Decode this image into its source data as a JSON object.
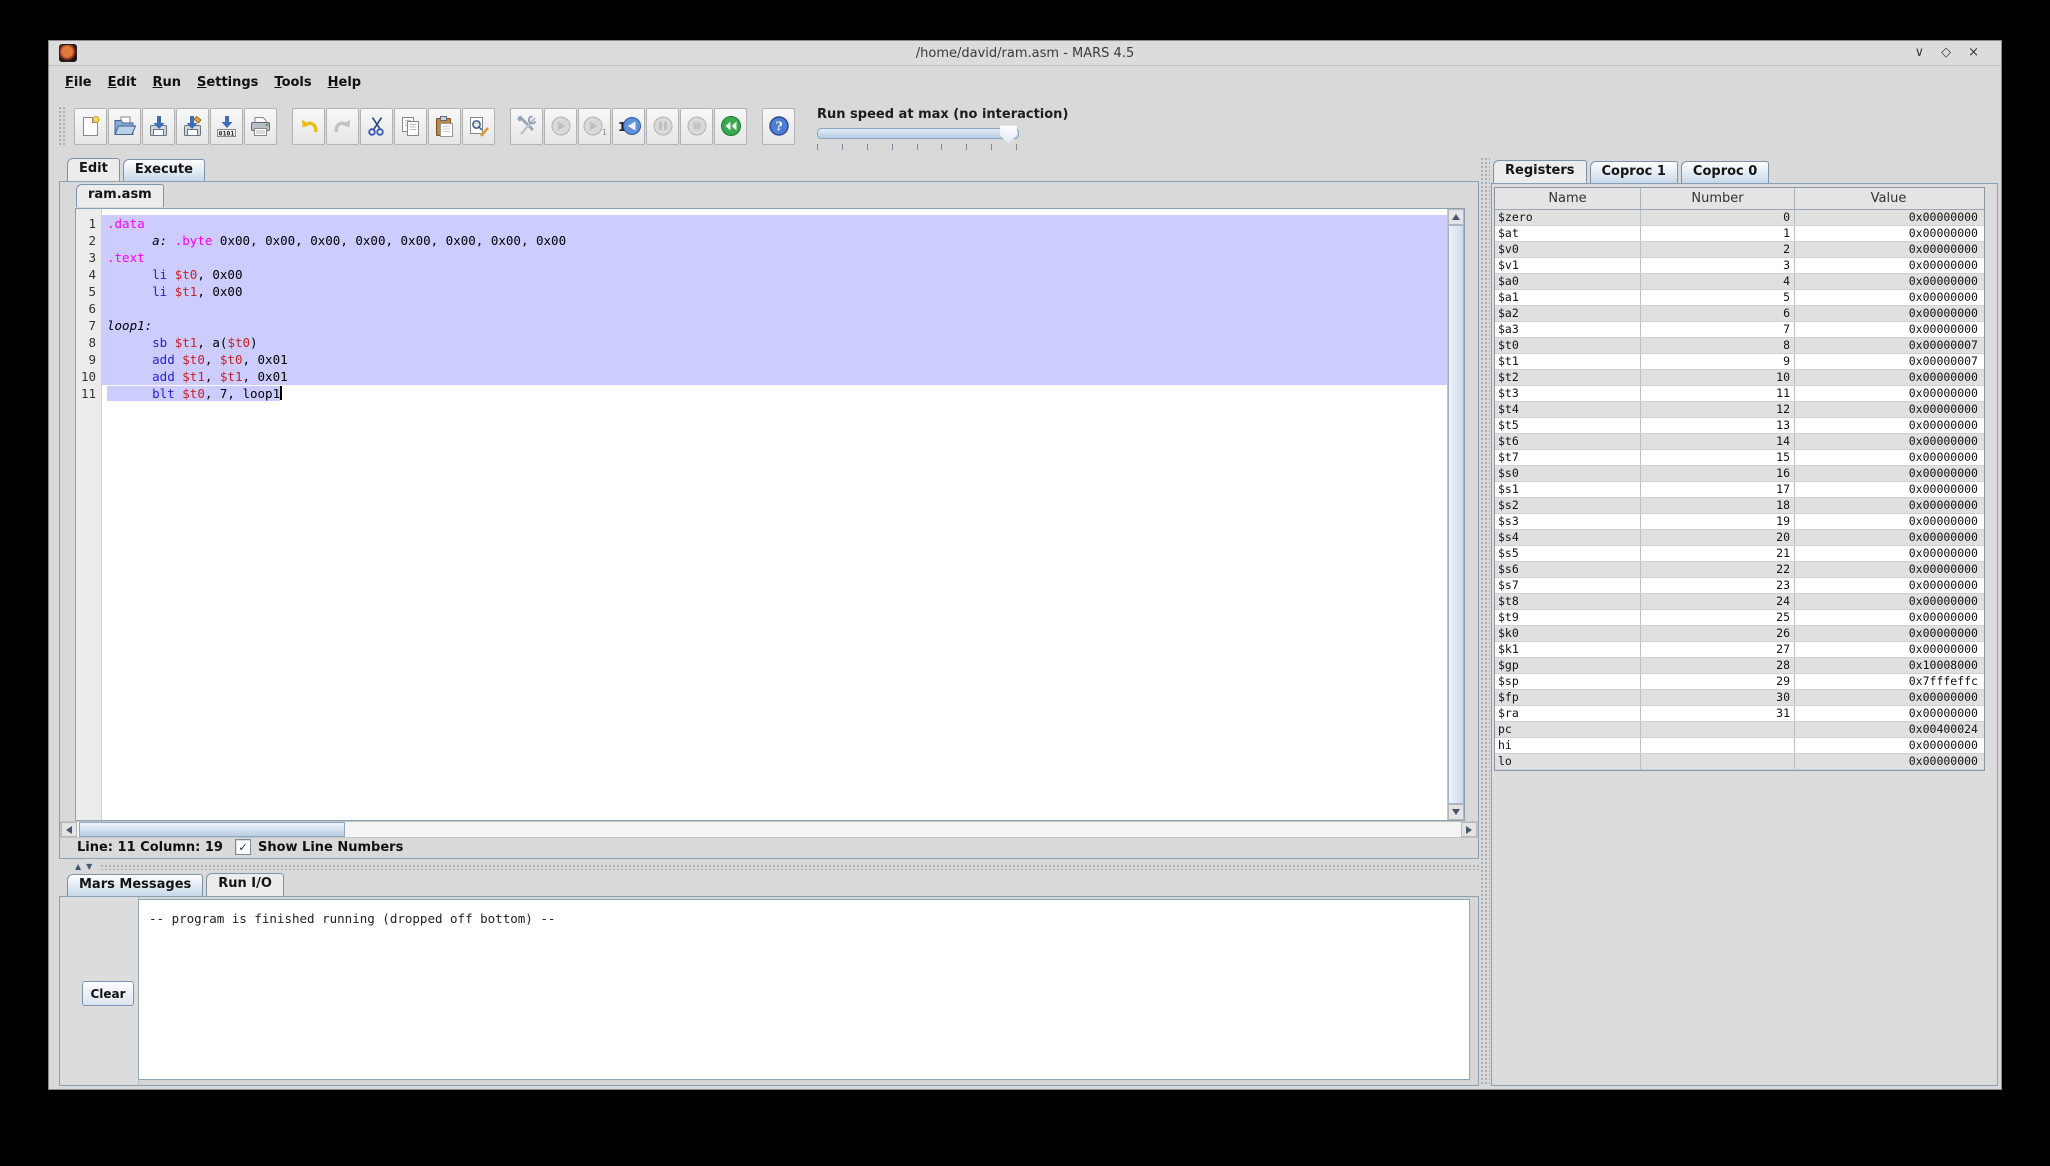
{
  "window": {
    "title": "/home/david/ram.asm - MARS 4.5",
    "controls": {
      "minimize": "∨",
      "maximize": "◇",
      "close": "×"
    }
  },
  "menu": {
    "items": [
      "File",
      "Edit",
      "Run",
      "Settings",
      "Tools",
      "Help"
    ]
  },
  "toolbar": {
    "groups": [
      [
        "new-file",
        "open-file",
        "save-file",
        "save-as",
        "dump-memory",
        "print"
      ],
      [
        "undo",
        "redo",
        "cut",
        "copy",
        "paste",
        "find-replace"
      ],
      [
        "assemble",
        "run",
        "step",
        "backstep",
        "pause",
        "stop",
        "reset"
      ],
      [
        "help"
      ]
    ],
    "run_speed_label": "Run speed at max (no interaction)"
  },
  "main_tabs": {
    "items": [
      {
        "label": "Edit",
        "selected": true
      },
      {
        "label": "Execute",
        "selected": false
      }
    ]
  },
  "splitter": {
    "up_glyph": "▲",
    "down_glyph": "▼"
  },
  "editor": {
    "file_tabs": [
      {
        "label": "ram.asm",
        "selected": true
      }
    ],
    "selection_color": "#ccccff",
    "syntax_colors": {
      "directive": "#ff00ff",
      "instruction": "#2323d7",
      "register": "#c92222",
      "label_style": "italic-black"
    },
    "lines": [
      {
        "num": "1",
        "sel": "full",
        "tokens": [
          [
            "dir",
            ".data"
          ]
        ]
      },
      {
        "num": "2",
        "sel": "full",
        "tokens": [
          [
            "pl",
            "      "
          ],
          [
            "lbl",
            "a:"
          ],
          [
            "pl",
            " "
          ],
          [
            "dir",
            ".byte"
          ],
          [
            "pl",
            " 0x00, 0x00, 0x00, 0x00, 0x00, 0x00, 0x00, 0x00"
          ]
        ]
      },
      {
        "num": "3",
        "sel": "full",
        "tokens": [
          [
            "dir",
            ".text"
          ]
        ]
      },
      {
        "num": "4",
        "sel": "full",
        "tokens": [
          [
            "pl",
            "      "
          ],
          [
            "ins",
            "li"
          ],
          [
            "pl",
            " "
          ],
          [
            "reg",
            "$t0"
          ],
          [
            "pl",
            ", 0x00"
          ]
        ]
      },
      {
        "num": "5",
        "sel": "full",
        "tokens": [
          [
            "pl",
            "      "
          ],
          [
            "ins",
            "li"
          ],
          [
            "pl",
            " "
          ],
          [
            "reg",
            "$t1"
          ],
          [
            "pl",
            ", 0x00"
          ]
        ]
      },
      {
        "num": "6",
        "sel": "full",
        "tokens": []
      },
      {
        "num": "7",
        "sel": "full",
        "tokens": [
          [
            "lbl",
            "loop1:"
          ]
        ]
      },
      {
        "num": "8",
        "sel": "full",
        "tokens": [
          [
            "pl",
            "      "
          ],
          [
            "ins",
            "sb"
          ],
          [
            "pl",
            " "
          ],
          [
            "reg",
            "$t1"
          ],
          [
            "pl",
            ", a("
          ],
          [
            "reg",
            "$t0"
          ],
          [
            "pl",
            ")"
          ]
        ]
      },
      {
        "num": "9",
        "sel": "full",
        "tokens": [
          [
            "pl",
            "      "
          ],
          [
            "ins",
            "add"
          ],
          [
            "pl",
            " "
          ],
          [
            "reg",
            "$t0"
          ],
          [
            "pl",
            ", "
          ],
          [
            "reg",
            "$t0"
          ],
          [
            "pl",
            ", 0x01"
          ]
        ]
      },
      {
        "num": "10",
        "sel": "full",
        "tokens": [
          [
            "pl",
            "      "
          ],
          [
            "ins",
            "add"
          ],
          [
            "pl",
            " "
          ],
          [
            "reg",
            "$t1"
          ],
          [
            "pl",
            ", "
          ],
          [
            "reg",
            "$t1"
          ],
          [
            "pl",
            ", 0x01"
          ]
        ]
      },
      {
        "num": "11",
        "sel": "inline",
        "caret": true,
        "tokens": [
          [
            "pl",
            "      "
          ],
          [
            "ins",
            "blt"
          ],
          [
            "pl",
            " "
          ],
          [
            "reg",
            "$t0"
          ],
          [
            "pl",
            ", 7, loop1"
          ]
        ]
      }
    ],
    "status": {
      "line_col": "Line: 11 Column: 19",
      "show_line_numbers_label": "Show Line Numbers",
      "checked": true,
      "check_glyph": "✓"
    }
  },
  "registers_panel": {
    "tabs": [
      {
        "label": "Registers",
        "selected": true
      },
      {
        "label": "Coproc 1",
        "selected": false
      },
      {
        "label": "Coproc 0",
        "selected": false
      }
    ],
    "columns": [
      "Name",
      "Number",
      "Value"
    ],
    "rows": [
      [
        "$zero",
        "0",
        "0x00000000"
      ],
      [
        "$at",
        "1",
        "0x00000000"
      ],
      [
        "$v0",
        "2",
        "0x00000000"
      ],
      [
        "$v1",
        "3",
        "0x00000000"
      ],
      [
        "$a0",
        "4",
        "0x00000000"
      ],
      [
        "$a1",
        "5",
        "0x00000000"
      ],
      [
        "$a2",
        "6",
        "0x00000000"
      ],
      [
        "$a3",
        "7",
        "0x00000000"
      ],
      [
        "$t0",
        "8",
        "0x00000007"
      ],
      [
        "$t1",
        "9",
        "0x00000007"
      ],
      [
        "$t2",
        "10",
        "0x00000000"
      ],
      [
        "$t3",
        "11",
        "0x00000000"
      ],
      [
        "$t4",
        "12",
        "0x00000000"
      ],
      [
        "$t5",
        "13",
        "0x00000000"
      ],
      [
        "$t6",
        "14",
        "0x00000000"
      ],
      [
        "$t7",
        "15",
        "0x00000000"
      ],
      [
        "$s0",
        "16",
        "0x00000000"
      ],
      [
        "$s1",
        "17",
        "0x00000000"
      ],
      [
        "$s2",
        "18",
        "0x00000000"
      ],
      [
        "$s3",
        "19",
        "0x00000000"
      ],
      [
        "$s4",
        "20",
        "0x00000000"
      ],
      [
        "$s5",
        "21",
        "0x00000000"
      ],
      [
        "$s6",
        "22",
        "0x00000000"
      ],
      [
        "$s7",
        "23",
        "0x00000000"
      ],
      [
        "$t8",
        "24",
        "0x00000000"
      ],
      [
        "$t9",
        "25",
        "0x00000000"
      ],
      [
        "$k0",
        "26",
        "0x00000000"
      ],
      [
        "$k1",
        "27",
        "0x00000000"
      ],
      [
        "$gp",
        "28",
        "0x10008000"
      ],
      [
        "$sp",
        "29",
        "0x7fffeffc"
      ],
      [
        "$fp",
        "30",
        "0x00000000"
      ],
      [
        "$ra",
        "31",
        "0x00000000"
      ],
      [
        "pc",
        "",
        "0x00400024"
      ],
      [
        "hi",
        "",
        "0x00000000"
      ],
      [
        "lo",
        "",
        "0x00000000"
      ]
    ]
  },
  "messages_panel": {
    "tabs": [
      {
        "label": "Mars Messages",
        "selected": false
      },
      {
        "label": "Run I/O",
        "selected": true
      }
    ],
    "clear_button": "Clear",
    "output": "-- program is finished running (dropped off bottom) --"
  }
}
